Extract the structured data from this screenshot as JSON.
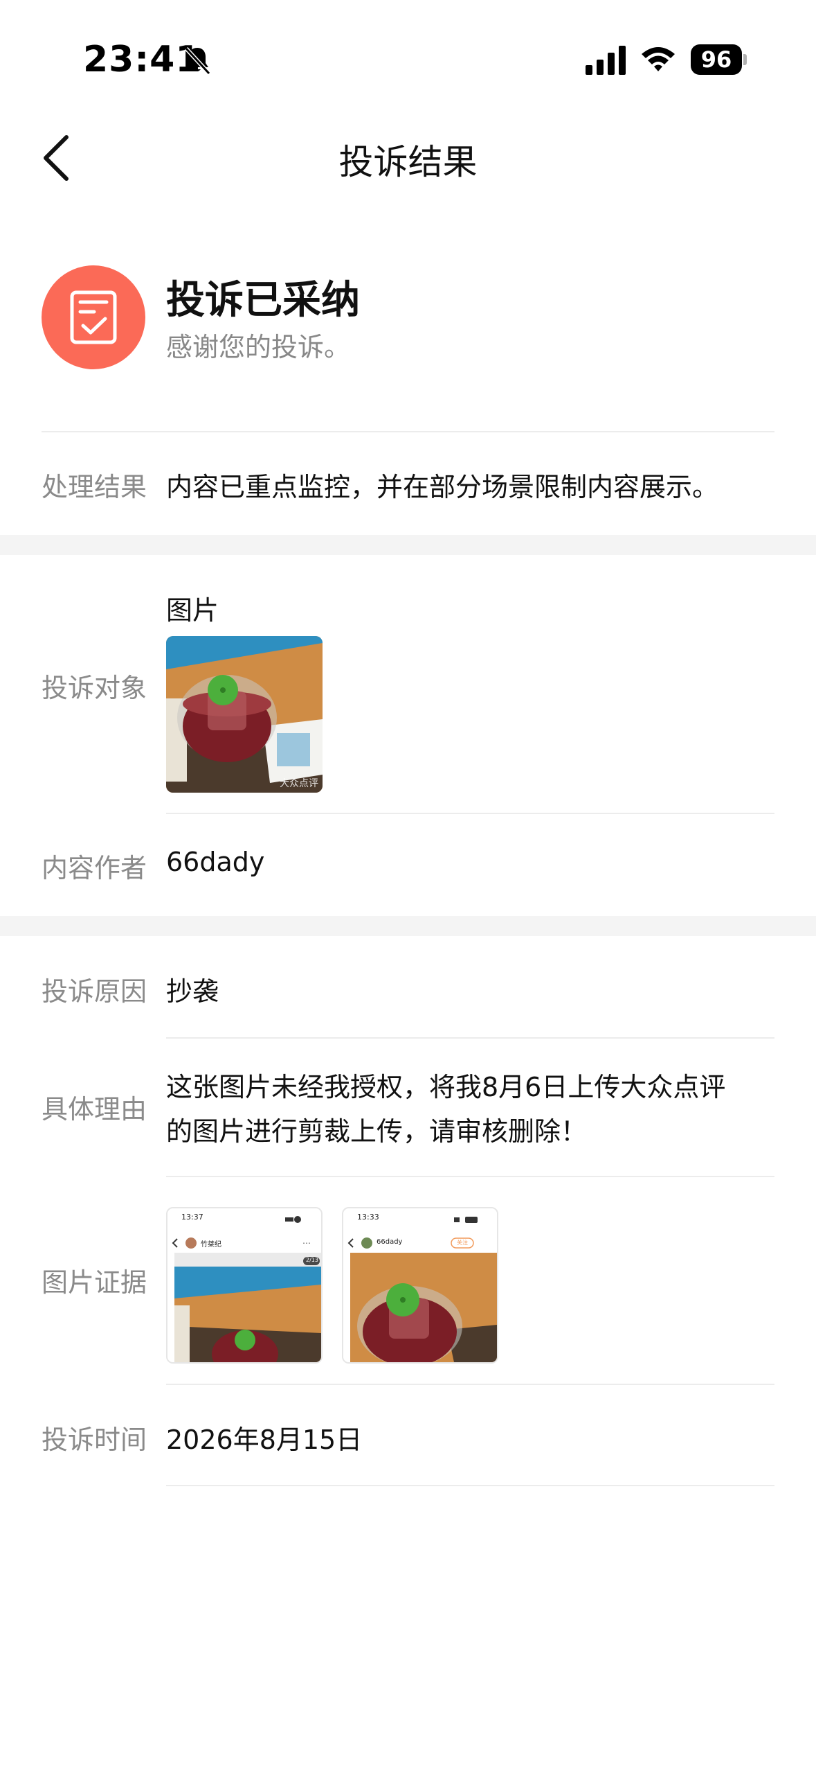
{
  "status_bar": {
    "time": "23:41",
    "battery": "96"
  },
  "nav": {
    "title": "投诉结果"
  },
  "result": {
    "title": "投诉已采纳",
    "subtitle": "感谢您的投诉。"
  },
  "handling": {
    "label": "处理结果",
    "value": "内容已重点监控，并在部分场景限制内容展示。"
  },
  "target": {
    "label": "投诉对象",
    "type": "图片",
    "thumb_watermark": "大众点评",
    "author_label": "内容作者",
    "author": "66dady"
  },
  "complaint": {
    "reason_label": "投诉原因",
    "reason": "抄袭",
    "detail_label": "具体理由",
    "detail_line1": "这张图片未经我授权，将我8月6日上传大众点评",
    "detail_line2": "的图片进行剪裁上传，请审核删除！",
    "evidence_label": "图片证据",
    "evidence": [
      {
        "time": "13:37",
        "user": "竹桀纪",
        "badge": "2/13"
      },
      {
        "time": "13:33",
        "user": "66dady",
        "badge": "关注"
      }
    ],
    "time_label": "投诉时间",
    "time": "2026年8月15日"
  },
  "colors": {
    "accent": "#fb6a57",
    "label": "#8a8a8a",
    "divider": "#ececec",
    "band": "#f4f4f4"
  }
}
